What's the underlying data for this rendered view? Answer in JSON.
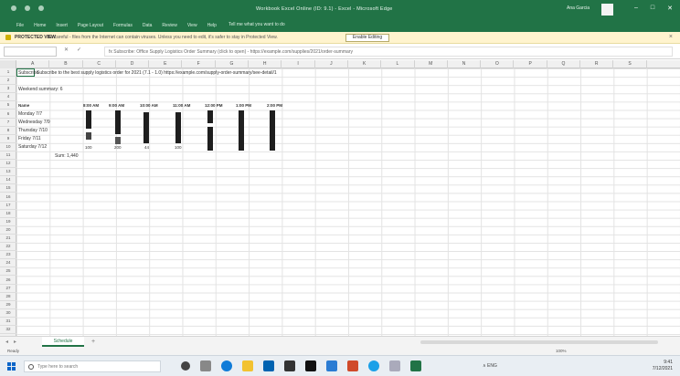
{
  "window": {
    "title": "Workbook Excel Online (ID: 9.1) - Excel - Microsoft Edge",
    "user": "Ana Garcia",
    "controls": [
      "–",
      "□",
      "✕"
    ]
  },
  "ribbon": {
    "tabs": [
      "File",
      "Home",
      "Insert",
      "Page Layout",
      "Formulas",
      "Data",
      "Review",
      "View",
      "Help"
    ],
    "tell_me": "Tell me what you want to do"
  },
  "notice": {
    "label": "PROTECTED VIEW",
    "text": "Be careful - files from the Internet can contain viruses. Unless you need to edit, it's safer to stay in Protected View.",
    "button": "Enable Editing"
  },
  "formula_bar": {
    "name_box": "",
    "value": "fx    Subscribe: Office Supply Logistics Order Summary (click to open) - https://example.com/supplies/2021/order-summary"
  },
  "columns": [
    "A",
    "B",
    "C",
    "D",
    "E",
    "F",
    "G",
    "H",
    "I",
    "J",
    "K",
    "L",
    "M",
    "N",
    "O",
    "P",
    "Q",
    "R",
    "S"
  ],
  "rows": [
    "1",
    "2",
    "3",
    "4",
    "5",
    "6",
    "7",
    "8",
    "9",
    "10",
    "11",
    "12",
    "13",
    "14",
    "15",
    "16",
    "17",
    "18",
    "19",
    "20",
    "21",
    "22",
    "23",
    "24",
    "25",
    "26",
    "27",
    "28",
    "29",
    "30",
    "31",
    "32"
  ],
  "sheet": {
    "a1": "Subscribe",
    "a1_rest": "Subscribe to the best supply logistics order for 2021 (7.1 - 1.0) https://example.com/supply-order-summary/see-detail/1",
    "a3": "Weekend summary: 6",
    "header": [
      "Name",
      "8:00 AM",
      "9:00 AM",
      "10:00 AM",
      "11:00 AM",
      "12:00 PM",
      "1:00 PM",
      "2:00 PM"
    ],
    "names": [
      "Monday 7/7",
      "Wednesday 7/9",
      "Thursday 7/10",
      "Friday 7/11",
      "Saturday 7/12"
    ],
    "bottom_row": [
      "100",
      "200",
      "44",
      "100"
    ],
    "total": "Sum: 1,440"
  },
  "sheet_tabs": {
    "active": "Schedule",
    "add": "+"
  },
  "status": {
    "ready": "Ready",
    "zoom": "100%"
  },
  "taskbar": {
    "search": "Type here to search",
    "tray": "∧  ENG",
    "time": "9:41",
    "date": "7/12/2021"
  },
  "colors": {
    "excel_green": "#217346",
    "notice_yellow": "#fff4ce"
  }
}
